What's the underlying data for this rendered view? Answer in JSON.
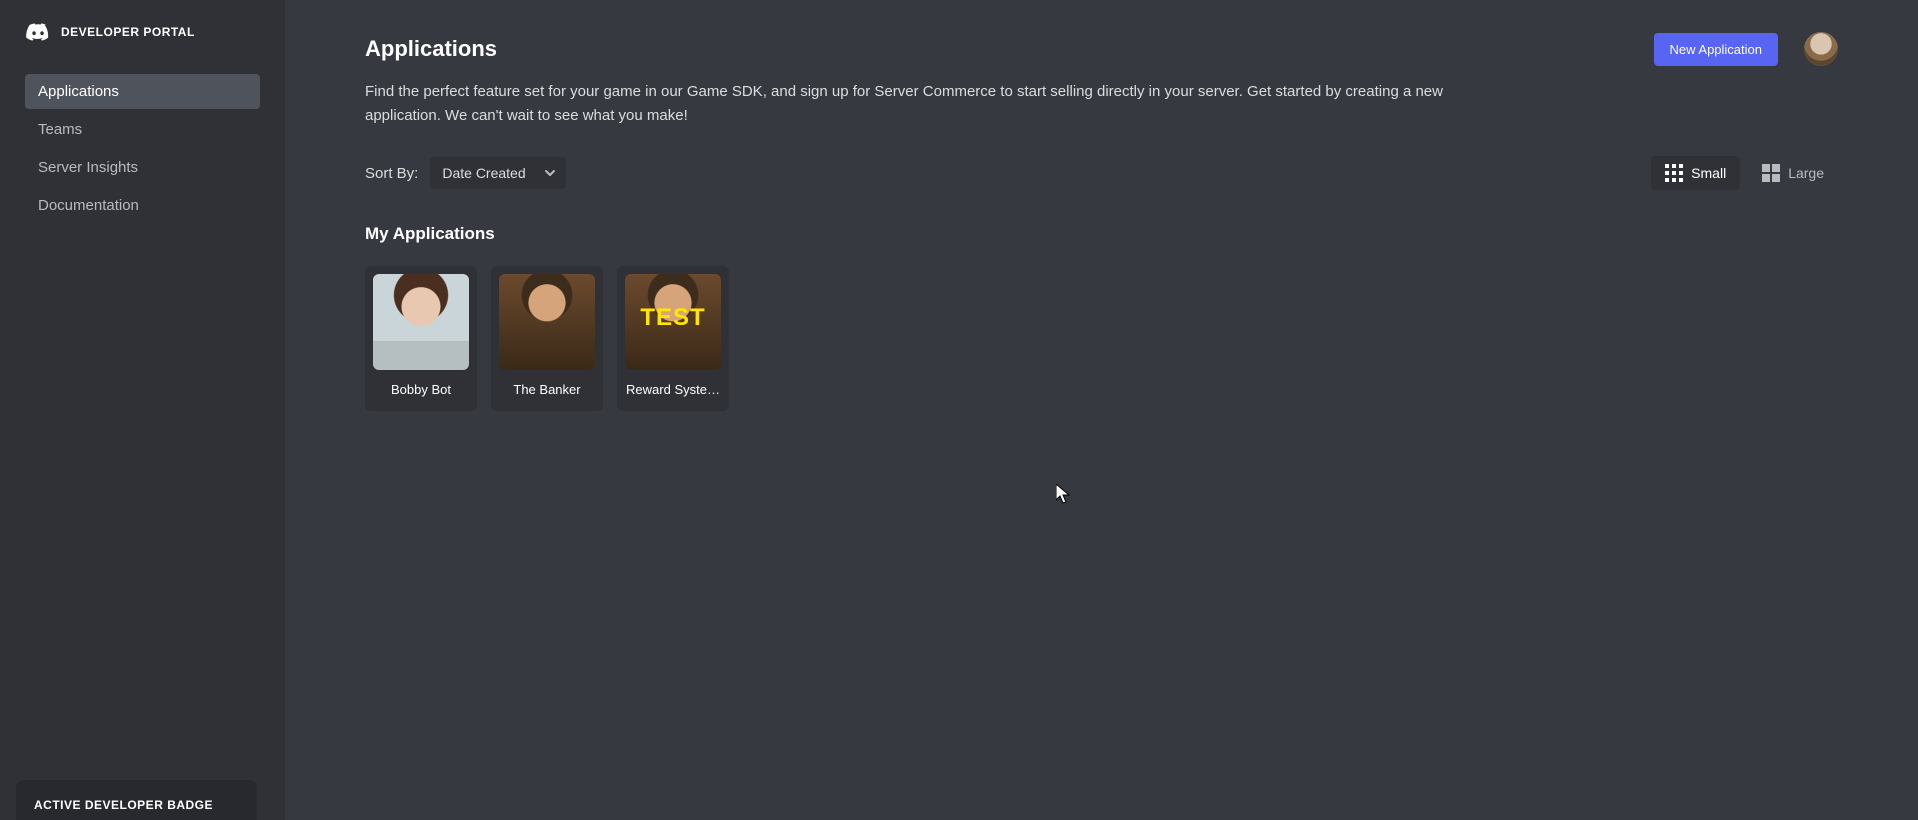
{
  "brand": {
    "name": "DEVELOPER PORTAL"
  },
  "nav": {
    "items": [
      {
        "label": "Applications",
        "active": true
      },
      {
        "label": "Teams",
        "active": false
      },
      {
        "label": "Server Insights",
        "active": false
      },
      {
        "label": "Documentation",
        "active": false
      }
    ]
  },
  "badge_card": {
    "title": "ACTIVE DEVELOPER BADGE"
  },
  "header": {
    "page_title": "Applications",
    "new_app_button": "New Application"
  },
  "intro_text": "Find the perfect feature set for your game in our Game SDK, and sign up for Server Commerce to start selling directly in your server. Get started by creating a new application. We can't wait to see what you make!",
  "sort": {
    "label": "Sort By:",
    "selected": "Date Created"
  },
  "view": {
    "small_label": "Small",
    "large_label": "Large",
    "selected": "small"
  },
  "section_title": "My Applications",
  "apps": [
    {
      "name": "Bobby Bot",
      "thumb_class": "thumb-bobby"
    },
    {
      "name": "The Banker",
      "thumb_class": "thumb-banker"
    },
    {
      "name": "Reward Syste…",
      "thumb_class": "thumb-test"
    }
  ],
  "colors": {
    "accent": "#5865f2",
    "bg_main": "#36393f",
    "bg_sidebar": "#2f3136",
    "bg_card": "#2f3136",
    "text_primary": "#ffffff",
    "text_muted": "#b9bbbe"
  }
}
